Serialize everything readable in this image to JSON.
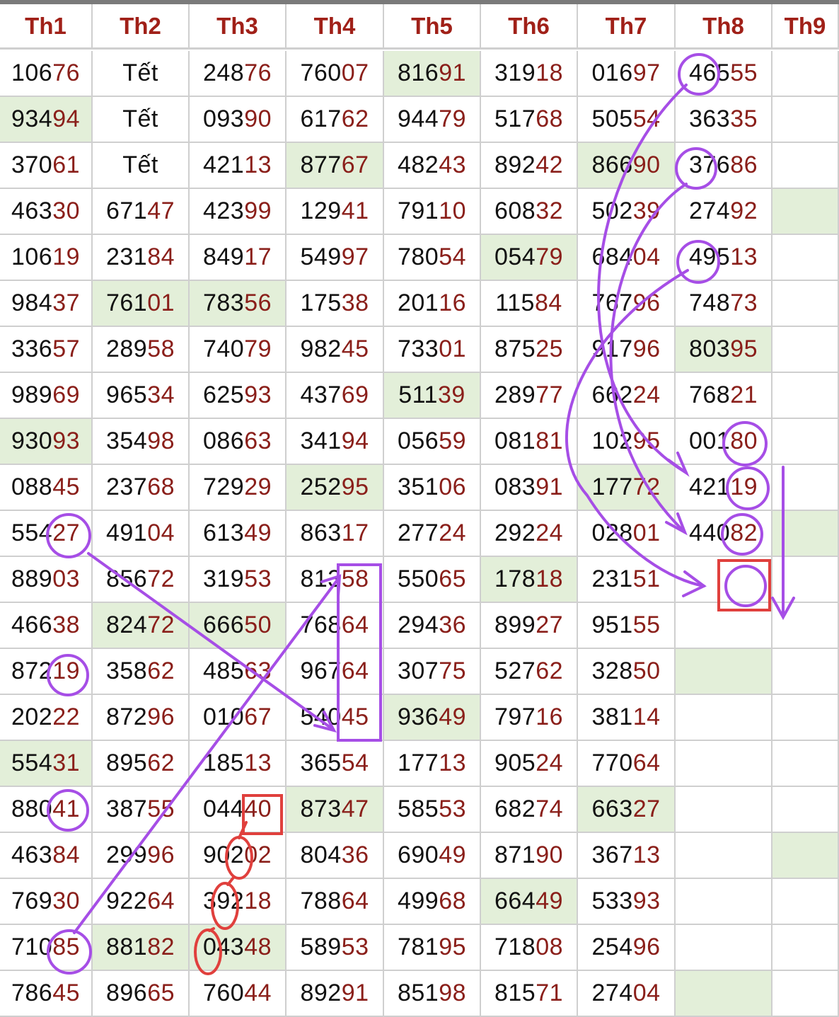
{
  "headers": [
    "Th1",
    "Th2",
    "Th3",
    "Th4",
    "Th5",
    "Th6",
    "Th7",
    "Th8",
    "Th9"
  ],
  "rows": [
    [
      "10676",
      "Tết",
      "24876",
      "76007",
      "81691",
      "31918",
      "01697",
      "46555",
      ""
    ],
    [
      "93494",
      "Tết",
      "09390",
      "61762",
      "94479",
      "51768",
      "50554",
      "36335",
      ""
    ],
    [
      "37061",
      "Tết",
      "42113",
      "87767",
      "48243",
      "89242",
      "86690",
      "37686",
      ""
    ],
    [
      "46330",
      "67147",
      "42399",
      "12941",
      "79110",
      "60832",
      "50239",
      "27492",
      ""
    ],
    [
      "10619",
      "23184",
      "84917",
      "54997",
      "78054",
      "05479",
      "68404",
      "49513",
      ""
    ],
    [
      "98437",
      "76101",
      "78356",
      "17538",
      "20116",
      "11584",
      "76796",
      "74873",
      ""
    ],
    [
      "33657",
      "28958",
      "74079",
      "98245",
      "73301",
      "87525",
      "91796",
      "80395",
      ""
    ],
    [
      "98969",
      "96534",
      "62593",
      "43769",
      "51139",
      "28977",
      "66224",
      "76821",
      ""
    ],
    [
      "93093",
      "35498",
      "08663",
      "34194",
      "05659",
      "08181",
      "10295",
      "00180",
      ""
    ],
    [
      "08845",
      "23768",
      "72929",
      "25295",
      "35106",
      "08391",
      "17772",
      "42119",
      ""
    ],
    [
      "55427",
      "49104",
      "61349",
      "86317",
      "27724",
      "29224",
      "02801",
      "44082",
      ""
    ],
    [
      "88903",
      "85672",
      "31953",
      "81358",
      "55065",
      "17818",
      "23151",
      "",
      ""
    ],
    [
      "46638",
      "82472",
      "66650",
      "76864",
      "29436",
      "89927",
      "95155",
      "",
      ""
    ],
    [
      "87219",
      "35862",
      "48563",
      "96764",
      "30775",
      "52762",
      "32850",
      "",
      ""
    ],
    [
      "20222",
      "87296",
      "01067",
      "54045",
      "93649",
      "79716",
      "38114",
      "",
      ""
    ],
    [
      "55431",
      "89562",
      "18513",
      "36554",
      "17713",
      "90524",
      "77064",
      "",
      ""
    ],
    [
      "88041",
      "38755",
      "04440",
      "87347",
      "58553",
      "68274",
      "66327",
      "",
      ""
    ],
    [
      "46384",
      "29996",
      "90202",
      "80436",
      "69049",
      "87190",
      "36713",
      "",
      ""
    ],
    [
      "76930",
      "92264",
      "39218",
      "78864",
      "49968",
      "66449",
      "53393",
      "",
      ""
    ],
    [
      "71085",
      "88182",
      "04348",
      "58953",
      "78195",
      "71808",
      "25496",
      "",
      ""
    ],
    [
      "78645",
      "89665",
      "76044",
      "89291",
      "85198",
      "81571",
      "27404",
      "",
      ""
    ]
  ],
  "highlights": [
    [
      0,
      4
    ],
    [
      1,
      0
    ],
    [
      2,
      3
    ],
    [
      2,
      6
    ],
    [
      3,
      8
    ],
    [
      4,
      5
    ],
    [
      5,
      1
    ],
    [
      5,
      2
    ],
    [
      6,
      7
    ],
    [
      7,
      4
    ],
    [
      8,
      0
    ],
    [
      9,
      3
    ],
    [
      9,
      6
    ],
    [
      10,
      8
    ],
    [
      11,
      5
    ],
    [
      12,
      1
    ],
    [
      12,
      2
    ],
    [
      13,
      7
    ],
    [
      14,
      4
    ],
    [
      15,
      0
    ],
    [
      16,
      3
    ],
    [
      16,
      6
    ],
    [
      17,
      8
    ],
    [
      18,
      5
    ],
    [
      19,
      1
    ],
    [
      19,
      2
    ],
    [
      20,
      7
    ]
  ],
  "colors": {
    "header_text": "#a02018",
    "tail_digits": "#8a1f1a",
    "highlight_bg": "#e3efd9",
    "purple_annotation": "#a64ee6",
    "red_annotation": "#e0403d"
  }
}
